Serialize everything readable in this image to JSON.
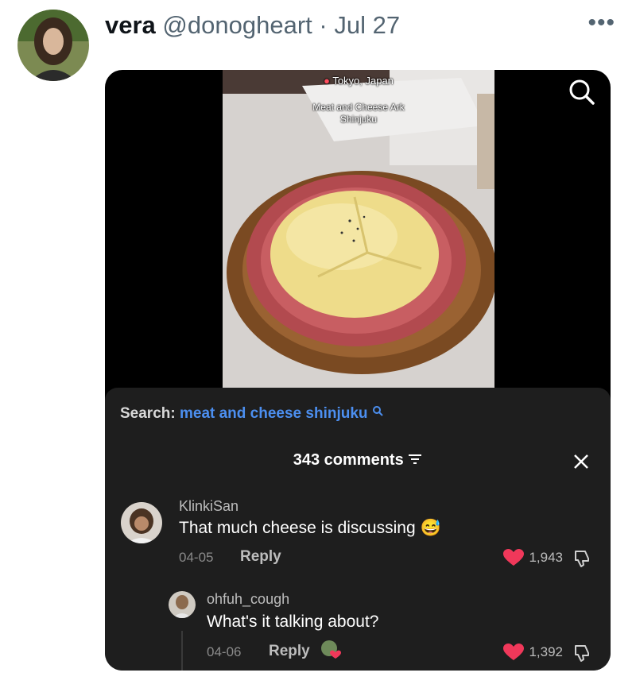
{
  "tweet": {
    "display_name": "vera",
    "handle": "@donogheart",
    "separator": "·",
    "date": "Jul 27",
    "more_icon": "more-horizontal-icon"
  },
  "video": {
    "location": "Tokyo, Japan",
    "place_line1": "Meat and Cheese Ark",
    "place_line2": "Shinjuku"
  },
  "comments_panel": {
    "search_label": "Search:",
    "search_query": "meat and cheese shinjuku",
    "count_label": "343 comments",
    "accent": "#4c8ff0",
    "comments": [
      {
        "username": "KlinkiSan",
        "text": "That much cheese is discussing",
        "emoji": "😅",
        "date": "04-05",
        "reply": "Reply",
        "likes": "1,943"
      },
      {
        "username": "ohfuh_cough",
        "text": "What's it talking about?",
        "date": "04-06",
        "reply": "Reply",
        "likes": "1,392"
      }
    ]
  },
  "colors": {
    "like_heart": "#f0385a",
    "panel_bg": "#1e1e1e"
  }
}
